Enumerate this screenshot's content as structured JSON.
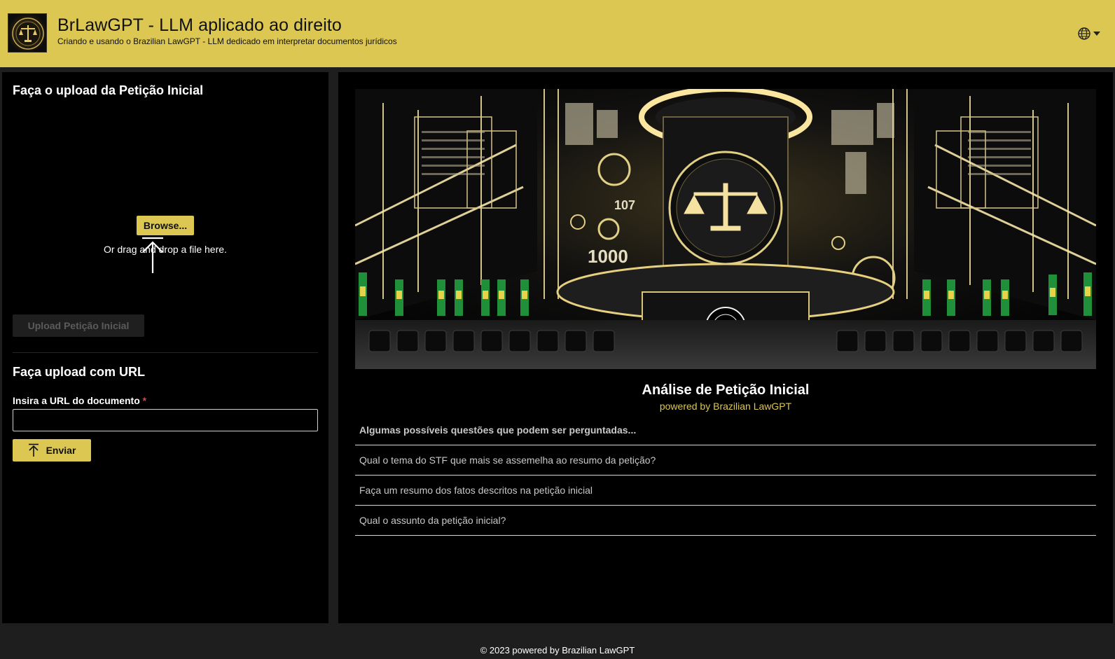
{
  "header": {
    "title": "BrLawGPT - LLM aplicado ao direito",
    "subtitle": "Criando e usando o Brazilian LawGPT - LLM dedicado em interpretar documentos jurídicos",
    "logo_icon": "scales-of-justice-icon",
    "language_icon": "globe-icon",
    "accent_color": "#dbc751"
  },
  "left": {
    "upload_title": "Faça o upload da Petição Inicial",
    "browse_label": "Browse...",
    "drag_text": "Or drag and drop a file here.",
    "upload_button": "Upload Petição Inicial",
    "url_title": "Faça upload com URL",
    "url_label": "Insira a URL do documento",
    "required_mark": "*",
    "url_value": "",
    "send_label": "Enviar"
  },
  "right": {
    "hero_label": "courtroom-image",
    "analysis_title": "Análise de Petição Inicial",
    "powered": "powered by Brazilian LawGPT",
    "questions_header": "Algumas possíveis questões que podem ser perguntadas...",
    "questions": [
      "Qual o tema do STF que mais se assemelha ao resumo da petição?",
      "Faça um resumo dos fatos descritos na petição inicial",
      "Qual o assunto da petição inicial?"
    ]
  },
  "footer": {
    "text": "© 2023 powered by Brazilian LawGPT"
  }
}
